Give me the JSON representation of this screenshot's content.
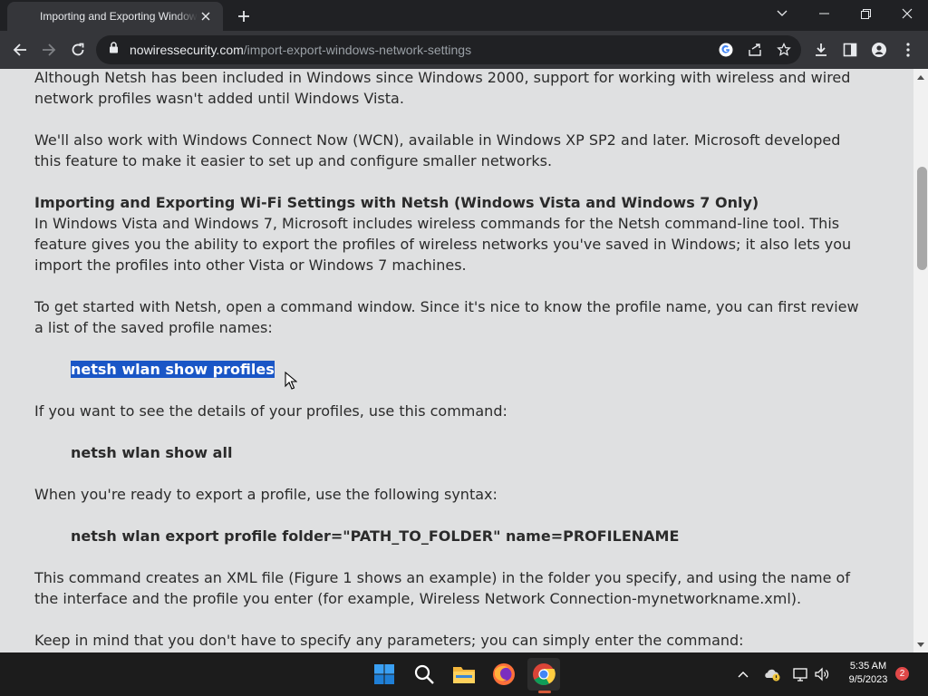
{
  "browser": {
    "tab_title": "Importing and Exporting Windows Network Settings",
    "url_host": "nowiressecurity.com",
    "url_path": "/import-export-windows-network-settings"
  },
  "article": {
    "p1": "Although Netsh has been included in Windows since Windows 2000, support for working with wireless and wired network profiles wasn't added until Windows Vista.",
    "p2": "We'll also work with Windows Connect Now (WCN), available in Windows XP SP2 and later. Microsoft developed this feature to make it easier to set up and configure smaller networks.",
    "heading": "Importing and Exporting Wi-Fi Settings with Netsh (Windows Vista and Windows 7 Only)",
    "p3": "In Windows Vista and Windows 7, Microsoft includes wireless commands for the Netsh command-line tool. This feature gives you the ability to export the profiles of wireless networks you've saved in Windows; it also lets you import the profiles into other Vista or Windows 7 machines.",
    "p4": "To get started with Netsh, open a command window. Since it's nice to know the profile name, you can first review a list of the saved profile names:",
    "cmd1": "netsh wlan show profiles",
    "p5": "If you want to see the details of your profiles, use this command:",
    "cmd2": "netsh wlan show all",
    "p6": "When you're ready to export a profile, use the following syntax:",
    "cmd3": "netsh wlan export profile folder=\"PATH_TO_FOLDER\" name=PROFILENAME",
    "p7": "This command creates an XML file (Figure 1 shows an example) in the folder you specify, and using the name of the interface and the profile you enter (for example, Wireless Network Connection-mynetworkname.xml).",
    "p8": "Keep in mind that you don't have to specify any parameters; you can simply enter the command:"
  },
  "taskbar": {
    "time": "5:35 AM",
    "date": "9/5/2023",
    "notification_count": "2",
    "apps": [
      "start-icon",
      "search-icon",
      "file-explorer-icon",
      "firefox-icon",
      "chrome-icon"
    ]
  },
  "colors": {
    "page_bg": "#dfe0e1",
    "selection": "#1a56c6",
    "chrome_dark": "#202124",
    "chrome_toolbar": "#35363a"
  }
}
